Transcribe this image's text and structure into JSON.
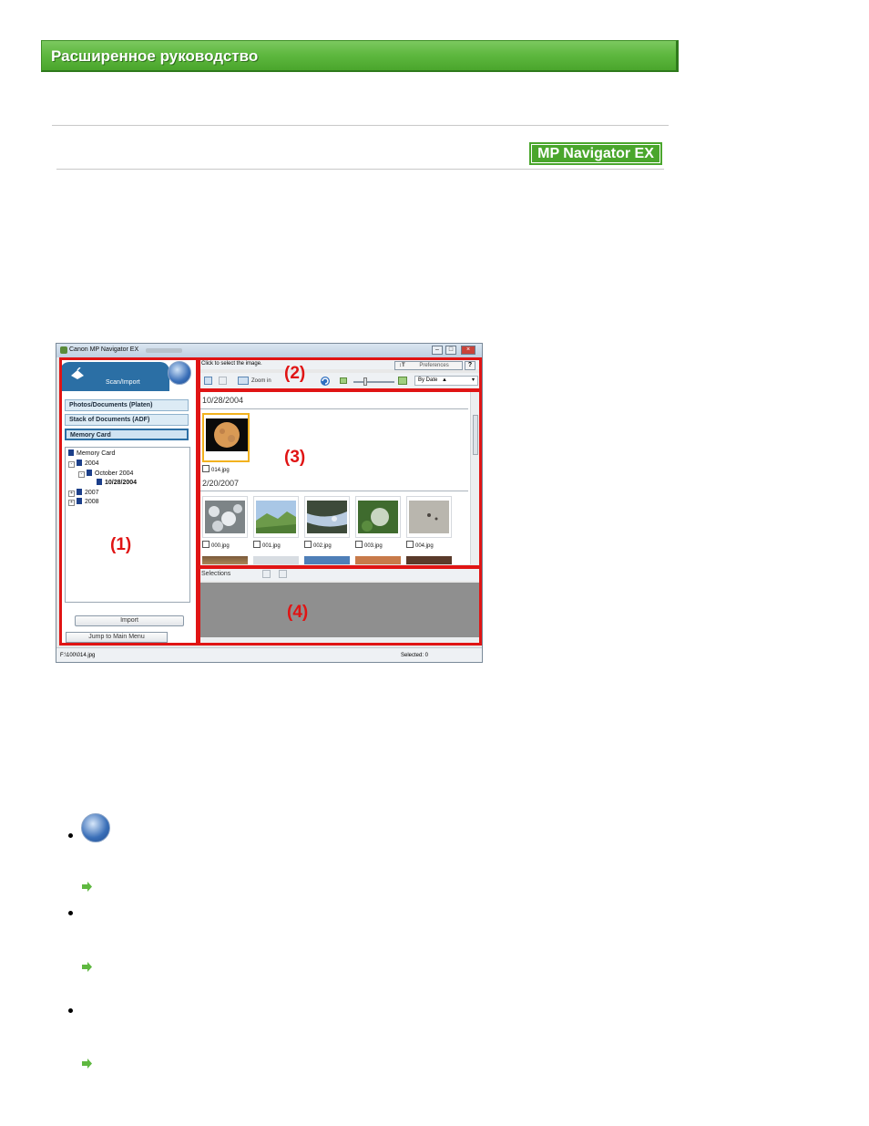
{
  "header": {
    "guide_title": "Расширенное руководство",
    "product_badge": "MP Navigator EX"
  },
  "window": {
    "title": "Canon MP Navigator EX",
    "left_pane": {
      "mode_tab": "Scan/Import",
      "sources": [
        "Photos/Documents (Platen)",
        "Stack of Documents (ADF)",
        "Memory Card"
      ],
      "tree": {
        "root": "Memory Card",
        "year_2004": "2004",
        "month": "October 2004",
        "day": "10/28/2004",
        "year_2007": "2007",
        "year_2008": "2008"
      },
      "import_label": "Import",
      "jump_label": "Jump to Main Menu"
    },
    "right_pane": {
      "hint": "Click to select the image.",
      "preferences_label": "Preferences",
      "help_label": "?",
      "zoom_label": "Zoom in",
      "sort_label": "By Date",
      "groups": [
        {
          "date": "10/28/2004",
          "files": [
            "014.jpg"
          ]
        },
        {
          "date": "2/20/2007",
          "files": [
            "000.jpg",
            "001.jpg",
            "002.jpg",
            "003.jpg",
            "004.jpg"
          ]
        }
      ],
      "selections_label": "Selections"
    },
    "status": {
      "path": "F:\\100\\014.jpg",
      "selected": "Selected: 0"
    }
  },
  "callouts": [
    "(1)",
    "(2)",
    "(3)",
    "(4)"
  ],
  "colors": {
    "banner_green": "#5fb840",
    "annotation_red": "#e01414",
    "accent_blue": "#2b6fa5",
    "selection_orange": "#f2b21e"
  },
  "icons": [
    "menu-globe-icon",
    "scan-icon",
    "arrow-link-icon",
    "memory-card-icon",
    "refresh-icon"
  ]
}
